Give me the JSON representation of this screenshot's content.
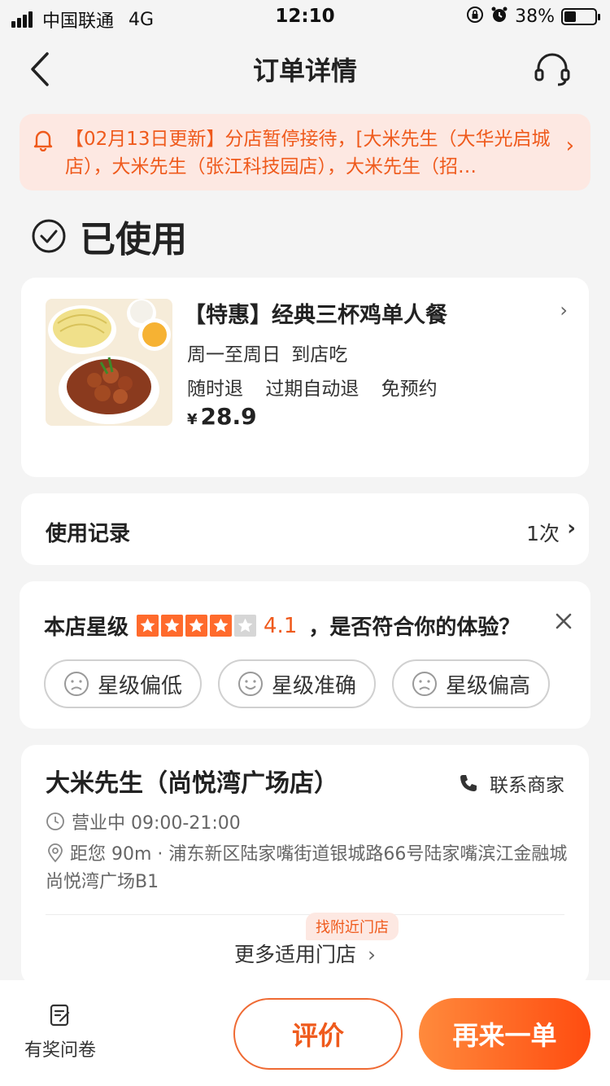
{
  "status_bar": {
    "carrier": "中国联通",
    "network": "4G",
    "time": "12:10",
    "battery": "38%",
    "battery_level": 0.38
  },
  "nav": {
    "title": "订单详情",
    "back_icon": "chevron-left-icon",
    "service_icon": "headset-icon"
  },
  "notice": {
    "text": "【02月13日更新】分店暂停接待，[大米先生（大华光启城店），大米先生（张江科技园店），大米先生（招…",
    "icon": "bell-icon"
  },
  "order_status": {
    "label": "已使用"
  },
  "product": {
    "name": "【特惠】经典三杯鸡单人餐",
    "availability": "周一至周日  到店吃",
    "policies": [
      "随时退",
      "过期自动退",
      "免预约"
    ],
    "currency": "¥",
    "price": "28.9"
  },
  "usage": {
    "label": "使用记录",
    "count": "1次"
  },
  "rating": {
    "prefix": "本店星级",
    "stars": 4,
    "max_stars": 5,
    "score": "4.1",
    "question": "，是否符合你的体验？",
    "options": [
      {
        "label": "星级偏低",
        "icon": "sad-face-icon"
      },
      {
        "label": "星级准确",
        "icon": "smile-face-icon"
      },
      {
        "label": "星级偏高",
        "icon": "sad-face-icon"
      }
    ],
    "star_color": "#ff6a2c"
  },
  "store": {
    "name": "大米先生（尚悦湾广场店）",
    "contact": "联系商家",
    "hours": "营业中 09:00-21:00",
    "address": "距您 90m · 浦东新区陆家嘴街道银城路66号陆家嘴滨江金融城尚悦湾广场B1",
    "nearby_tag": "找附近门店",
    "more_stores": "更多适用门店"
  },
  "bottom_bar": {
    "survey": "有奖问卷",
    "review": "评价",
    "reorder": "再来一单"
  },
  "colors": {
    "accent": "#ef5a1c",
    "background": "#f4f4f4"
  }
}
